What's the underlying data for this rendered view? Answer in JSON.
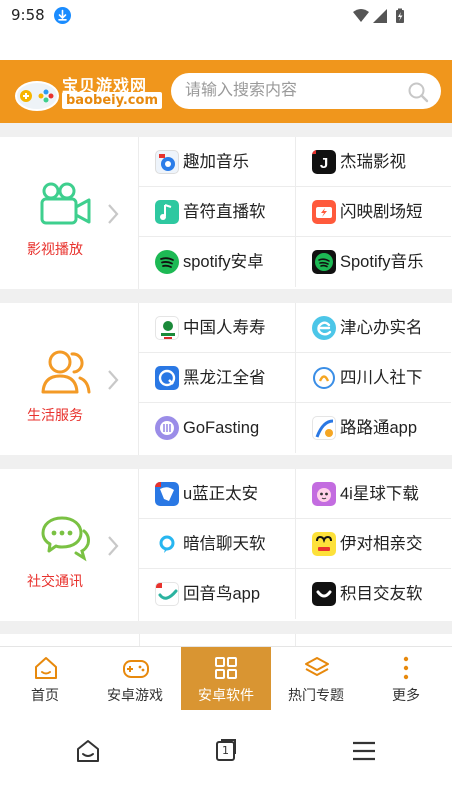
{
  "status": {
    "time": "9:58"
  },
  "header": {
    "logo_title": "宝贝游戏网",
    "logo_domain": "baobeiy.com",
    "search_placeholder": "请输入搜索内容"
  },
  "sections": [
    {
      "label": "影视播放",
      "icon": "video-camera-icon",
      "color": "#3ecf8e",
      "apps": [
        {
          "name": "趣加音乐",
          "icon": "quja-music-icon"
        },
        {
          "name": "杰瑞影视",
          "icon": "jerry-video-icon"
        },
        {
          "name": "音符直播软",
          "icon": "music-note-live-icon"
        },
        {
          "name": "闪映剧场短",
          "icon": "shanying-theater-icon"
        },
        {
          "name": "spotify安卓",
          "icon": "spotify-icon"
        },
        {
          "name": "Spotify音乐",
          "icon": "spotify-music-icon"
        }
      ]
    },
    {
      "label": "生活服务",
      "icon": "users-icon",
      "color": "#f39a26",
      "apps": [
        {
          "name": "中国人寿寿",
          "icon": "china-life-icon"
        },
        {
          "name": "津心办实名",
          "icon": "jinxinban-icon"
        },
        {
          "name": "黑龙江全省",
          "icon": "heilongjiang-icon"
        },
        {
          "name": "四川人社下",
          "icon": "sichuan-social-icon"
        },
        {
          "name": "GoFasting",
          "icon": "gofasting-icon"
        },
        {
          "name": "路路通app",
          "icon": "lulutong-icon"
        }
      ]
    },
    {
      "label": "社交通讯",
      "icon": "chat-bubbles-icon",
      "color": "#7ac143",
      "apps": [
        {
          "name": "u蓝正太安",
          "icon": "ulan-icon"
        },
        {
          "name": "4i星球下载",
          "icon": "4i-planet-icon"
        },
        {
          "name": "暗信聊天软",
          "icon": "anxin-chat-icon"
        },
        {
          "name": "伊对相亲交",
          "icon": "yidui-icon"
        },
        {
          "name": "回音鸟app",
          "icon": "echo-bird-icon"
        },
        {
          "name": "积目交友软",
          "icon": "jimu-icon"
        }
      ]
    }
  ],
  "bottom_nav": [
    {
      "label": "首页",
      "icon": "home-icon"
    },
    {
      "label": "安卓游戏",
      "icon": "gamepad-icon"
    },
    {
      "label": "安卓软件",
      "icon": "grid-icon",
      "active": true
    },
    {
      "label": "热门专题",
      "icon": "layers-icon"
    },
    {
      "label": "更多",
      "icon": "more-dots-icon"
    }
  ],
  "system_nav": {
    "tab_count": "1"
  },
  "colors": {
    "brand": "#f0961c",
    "active_nav": "#d99532",
    "category_label": "#e8322d"
  }
}
